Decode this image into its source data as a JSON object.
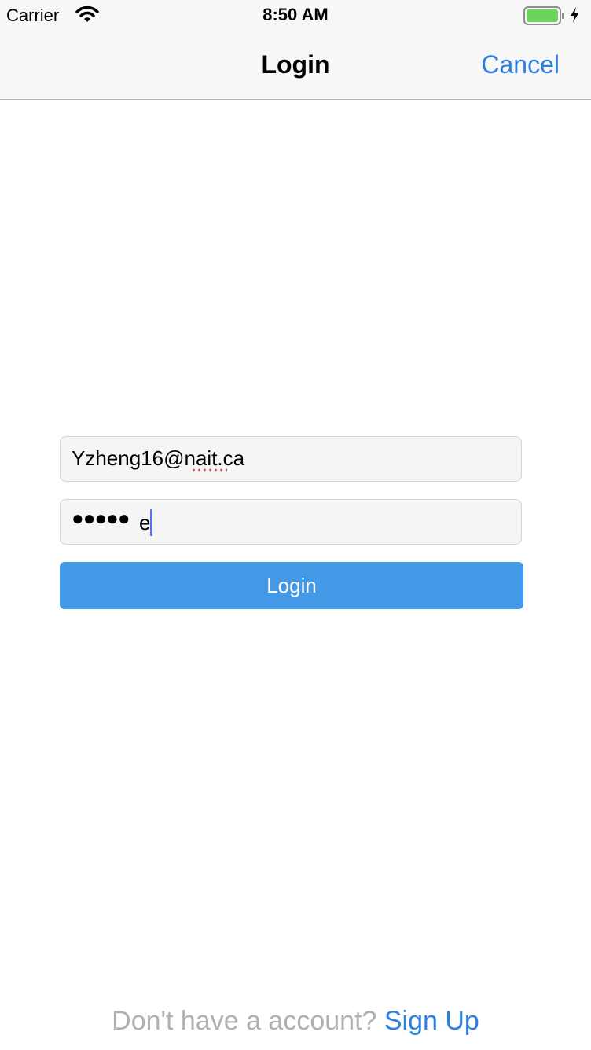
{
  "status_bar": {
    "carrier": "Carrier",
    "time": "8:50 AM",
    "icons": [
      "wifi-icon",
      "battery-icon",
      "charging-icon"
    ],
    "battery_color": "#6cd45c"
  },
  "nav": {
    "title": "Login",
    "cancel_label": "Cancel"
  },
  "form": {
    "email_value": "Yzheng16@nait.ca",
    "password_masked": "●●●●●",
    "password_last_char": "e",
    "login_label": "Login"
  },
  "footer": {
    "prompt": "Don't have a account? ",
    "signup_label": "Sign Up"
  },
  "colors": {
    "accent": "#2f7fe3",
    "button": "#4499e6"
  }
}
